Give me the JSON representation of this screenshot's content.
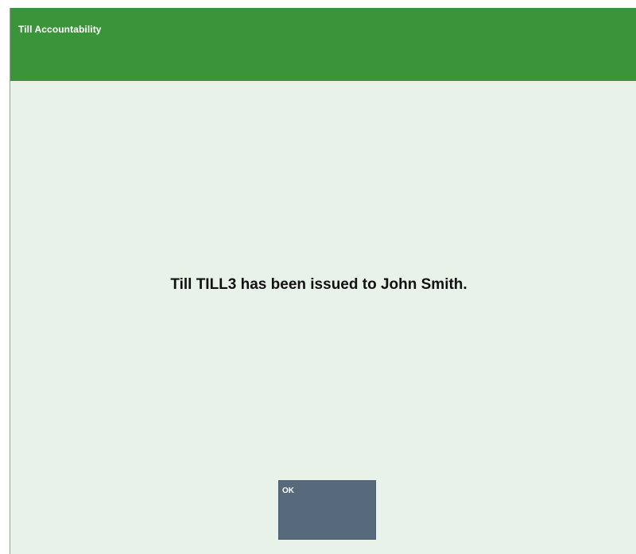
{
  "window": {
    "title": "Till Accountability"
  },
  "dialog": {
    "message": "Till TILL3 has been issued to John Smith.",
    "ok_label": "OK"
  },
  "colors": {
    "header": "#3a953a",
    "background": "#e9f2e8",
    "button": "#566a7c"
  }
}
